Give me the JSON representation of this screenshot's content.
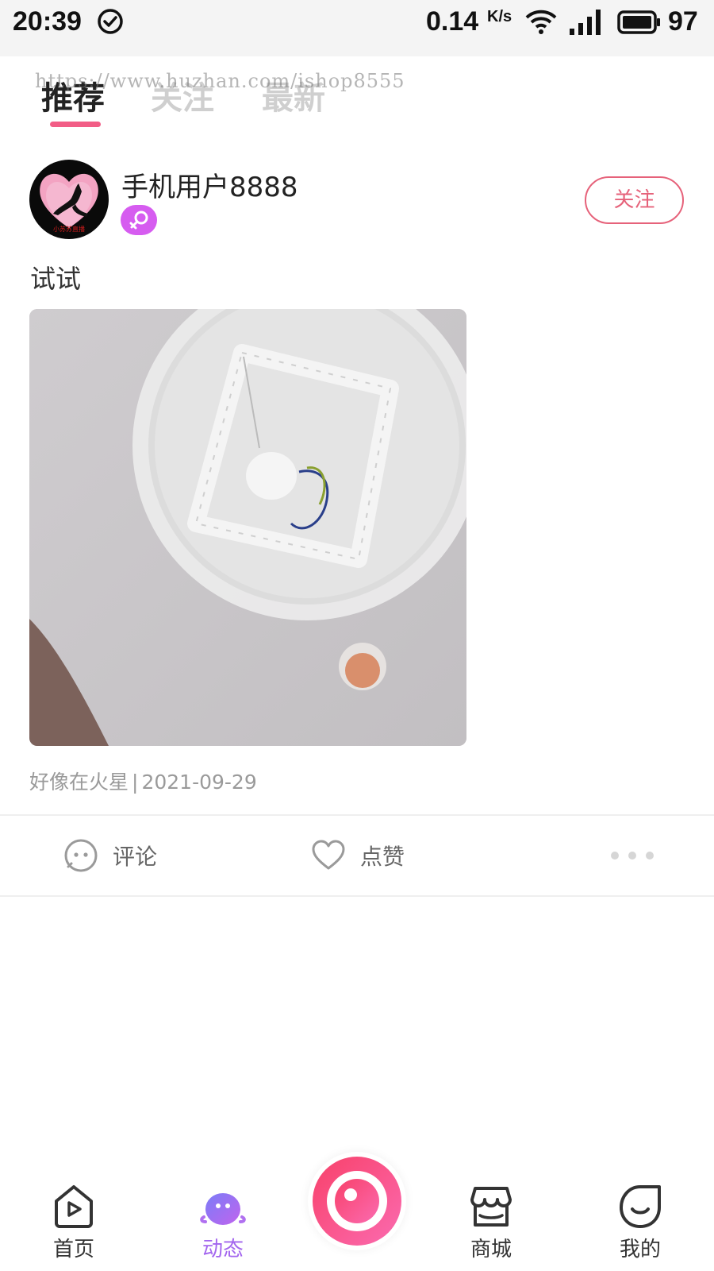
{
  "status_bar": {
    "time": "20:39",
    "net_speed": "0.14",
    "net_unit": "K/s",
    "battery": "97"
  },
  "tabs": [
    {
      "label": "推荐",
      "active": true
    },
    {
      "label": "关注",
      "active": false
    },
    {
      "label": "最新",
      "active": false
    }
  ],
  "watermark": "https://www.huzhan.com/ishop8555",
  "post": {
    "avatar_text": "小苏苏直播",
    "username": "手机用户8888",
    "gender_icon": "female-icon",
    "follow_label": "关注",
    "text": "试试",
    "location": "好像在火星",
    "meta_separator": "|",
    "date": "2021-09-29",
    "actions": {
      "comment_label": "评论",
      "like_label": "点赞"
    }
  },
  "bottom_nav": [
    {
      "label": "首页",
      "icon": "home-play-icon",
      "active": false
    },
    {
      "label": "动态",
      "icon": "feed-blob-icon",
      "active": true
    },
    {
      "label": "",
      "icon": "live-camera-icon",
      "active": false
    },
    {
      "label": "商城",
      "icon": "store-icon",
      "active": false
    },
    {
      "label": "我的",
      "icon": "profile-icon",
      "active": false
    }
  ],
  "colors": {
    "accent_pink": "#f25d86",
    "follow_border": "#e6627a",
    "active_nav": "#a366ee",
    "gender_badge": "#d65cf0",
    "meta_text": "#9a9a9a",
    "inactive_tab": "#cfcfcf"
  }
}
